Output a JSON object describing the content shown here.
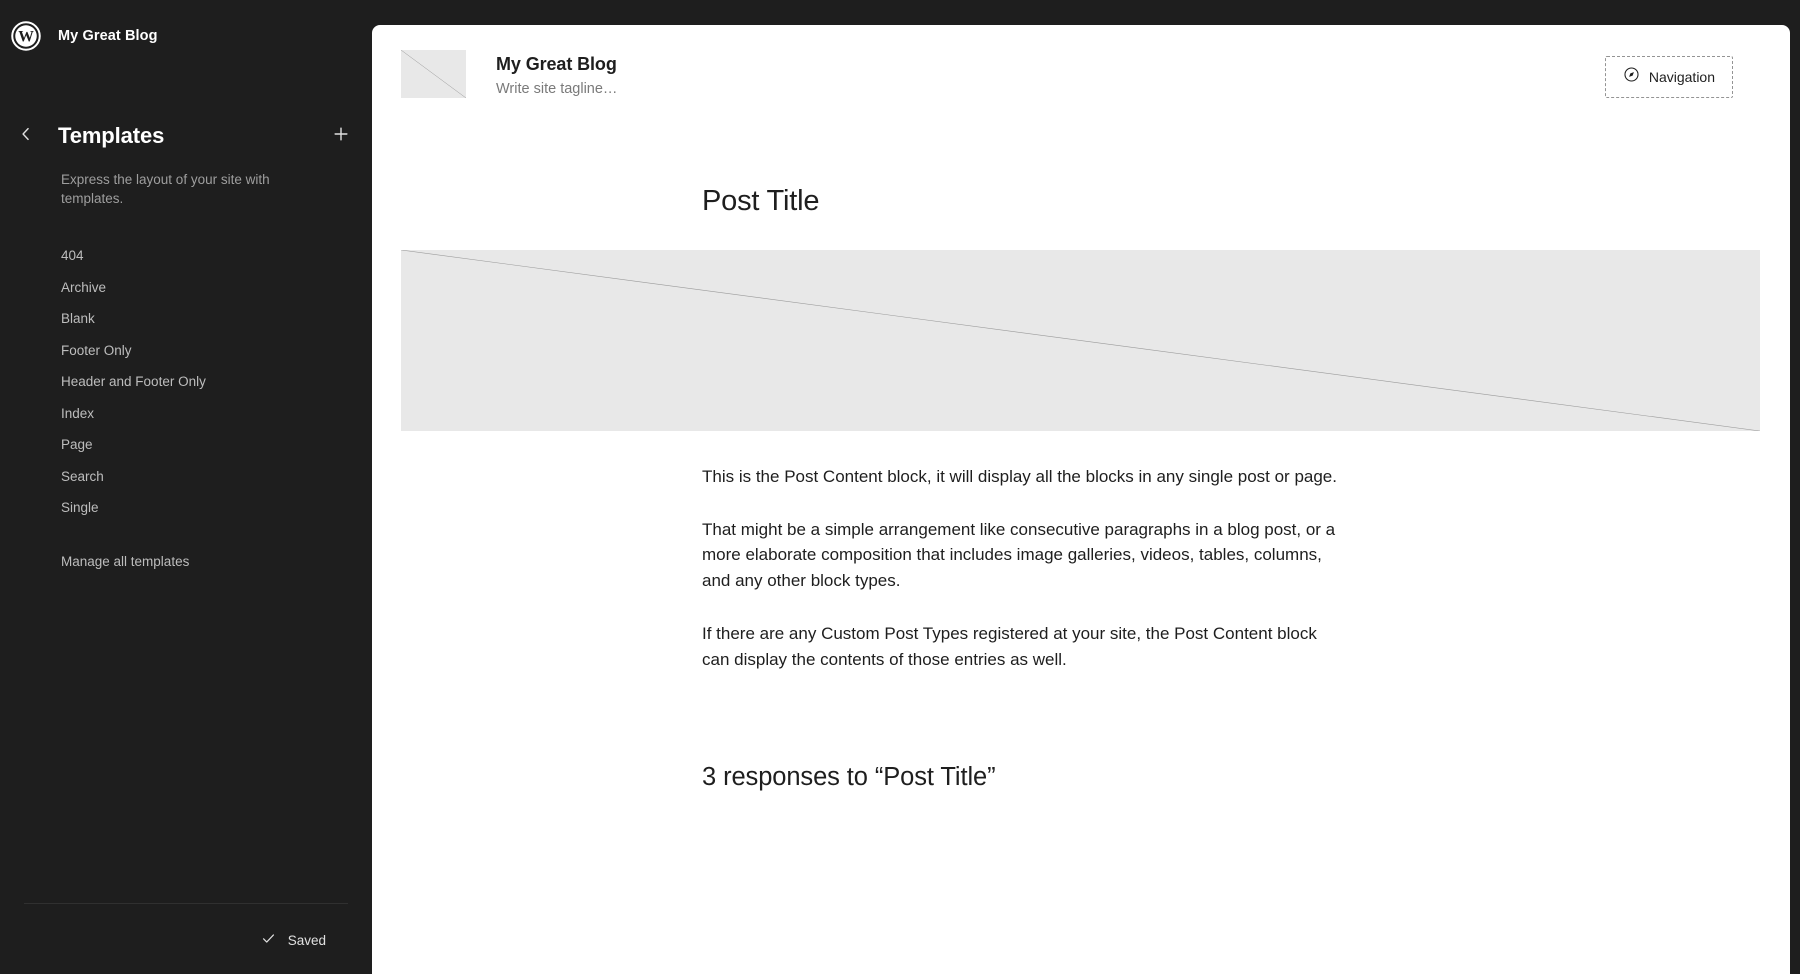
{
  "colors": {
    "sidebar_bg": "#1e1e1e",
    "canvas_bg": "#ffffff",
    "placeholder_gray": "#e8e8e8",
    "muted_text": "#9e9e9e",
    "list_text": "#bdbdbd",
    "divider": "#303030"
  },
  "sidebar": {
    "site_hub": {
      "logo_icon": "wordpress-logo-icon",
      "site_name": "My Great Blog"
    },
    "panel": {
      "back_icon": "chevron-left-icon",
      "title": "Templates",
      "add_icon": "plus-icon",
      "description": "Express the layout of your site with templates."
    },
    "templates": [
      {
        "label": "404"
      },
      {
        "label": "Archive"
      },
      {
        "label": "Blank"
      },
      {
        "label": "Footer Only"
      },
      {
        "label": "Header and Footer Only"
      },
      {
        "label": "Index"
      },
      {
        "label": "Page"
      },
      {
        "label": "Search"
      },
      {
        "label": "Single"
      }
    ],
    "manage_all_label": "Manage all templates",
    "footer": {
      "save_icon": "check-icon",
      "save_status": "Saved"
    }
  },
  "canvas": {
    "site_header": {
      "logo_icon": "image-placeholder-icon",
      "site_title": "My Great Blog",
      "tagline_placeholder": "Write site tagline…",
      "navigation": {
        "icon": "compass-navigation-icon",
        "label": "Navigation"
      }
    },
    "post": {
      "title": "Post Title",
      "featured_image_icon": "image-placeholder-icon",
      "paragraphs": [
        "This is the Post Content block, it will display all the blocks in any single post or page.",
        "That might be a simple arrangement like consecutive paragraphs in a blog post, or a more elaborate composition that includes image galleries, videos, tables, columns, and any other block types.",
        "If there are any Custom Post Types registered at your site, the Post Content block can display the contents of those entries as well."
      ]
    },
    "comments": {
      "heading": "3 responses to “Post Title”"
    }
  }
}
